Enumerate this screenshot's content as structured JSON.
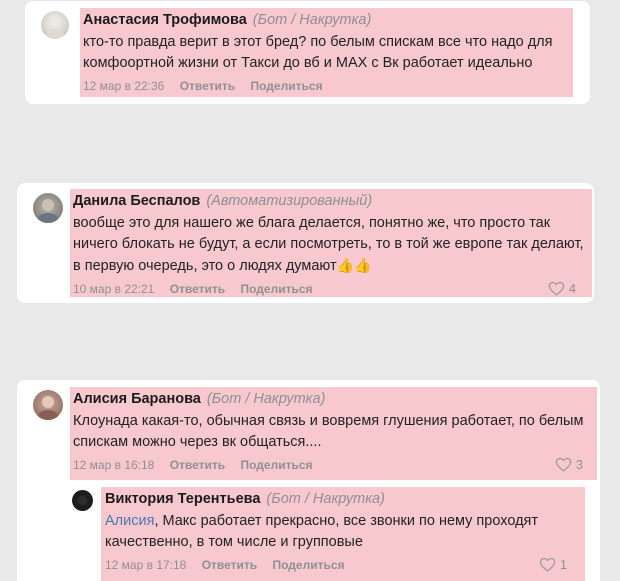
{
  "comments": [
    {
      "author": "Анастасия Трофимова",
      "tag": "(Бот / Накрутка)",
      "text": "кто-то правда верит в этот бред? по белым спискам все что надо для комфоортной жизни от Такси до вб и MAX с Вк работает идеально",
      "date": "12 мар в 22:36",
      "reply": "Ответить",
      "share": "Поделиться"
    },
    {
      "author": "Данила Беспалов",
      "tag": "(Автоматизированный)",
      "text": "вообще это для нашего же блага делается, понятно же, что просто так ничего блокать не будут, а если посмотреть, то в той же европе так делают, в первую очередь, это о людях думают",
      "emoji": "👍👍",
      "date": "10 мар в 22:21",
      "reply": "Ответить",
      "share": "Поделиться",
      "likes": "4"
    },
    {
      "author": "Алисия Баранова",
      "tag": "(Бот / Накрутка)",
      "text": "Клоунада какая-то, обычная связь и вовремя глушения работает, по белым спискам можно через вк общаться....",
      "date": "12 мар в 16:18",
      "reply": "Ответить",
      "share": "Поделиться",
      "likes": "3"
    },
    {
      "author": "Виктория Терентьева",
      "tag": "(Бот / Накрутка)",
      "mention": "Алисия",
      "text": ", Макс работает прекрасно, все звонки по нему проходят качественно, в том числе и групповые",
      "date": "12 мар в 17:18",
      "reply": "Ответить",
      "share": "Поделиться",
      "likes": "1"
    }
  ],
  "colors": {
    "highlight": "#f7c9cf",
    "card": "#ffffff",
    "background": "#e9e9ea",
    "mention": "#4a77b4",
    "tag": "#8e8e93"
  },
  "icons": {
    "like": "heart-icon"
  }
}
